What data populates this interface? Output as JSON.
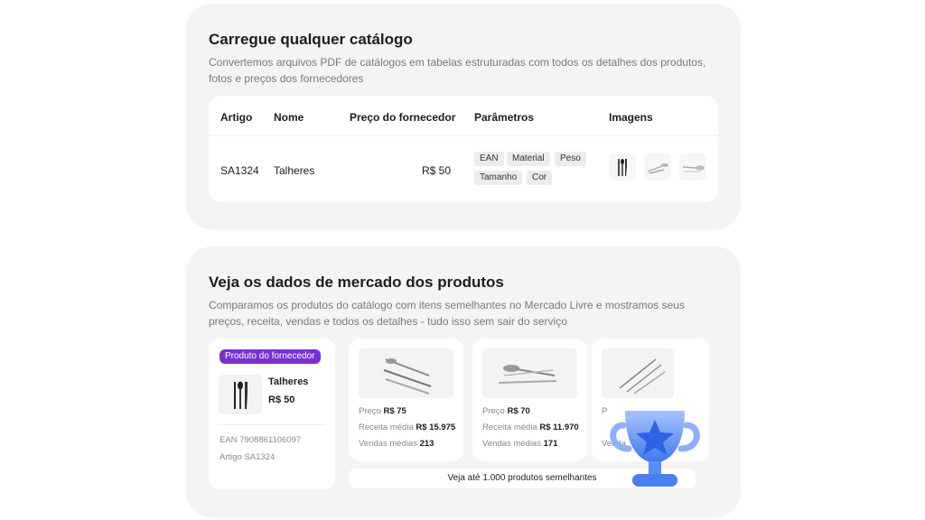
{
  "catalog": {
    "title": "Carregue qualquer catálogo",
    "description": "Convertemos arquivos PDF de catálogos em tabelas estruturadas com todos os detalhes dos produtos, fotos e preços dos fornecedores",
    "columns": [
      "Artigo",
      "Nome",
      "Preço do fornecedor",
      "Parâmetros",
      "Imagens"
    ],
    "row": {
      "article": "SA1324",
      "name": "Talheres",
      "price": "R$ 50",
      "params": [
        "EAN",
        "Material",
        "Peso",
        "Tamanho",
        "Cor"
      ],
      "images": [
        "cutlery-set-icon",
        "spoons-icon",
        "spoon-icon"
      ]
    }
  },
  "market": {
    "title": "Veja os dados de mercado dos produtos",
    "description": "Comparamos os produtos do catálogo com itens semelhantes no Mercado Livre e mostramos seus preços, receita, vendas e todos os detalhes - tudo isso sem sair do serviço",
    "supplier": {
      "badge": "Produto do fornecedor",
      "name": "Talheres",
      "price": "R$ 50",
      "ean_label": "EAN",
      "ean": "7908861106097",
      "article_label": "Artigo",
      "article": "SA1324"
    },
    "items": [
      {
        "price_label": "Preço",
        "price": "R$ 75",
        "revenue_label": "Receita média",
        "revenue": "R$ 15.975",
        "sales_label": "Vendas médias",
        "sales": "213"
      },
      {
        "price_label": "Preço",
        "price": "R$ 70",
        "revenue_label": "Receita média",
        "revenue": "R$ 11.970",
        "sales_label": "Vendas médias",
        "sales": "171"
      },
      {
        "price_label": "P",
        "price": "",
        "revenue_label": "",
        "revenue": "",
        "sales_label": "Venda",
        "sales": ""
      }
    ],
    "more_link": "Veja até 1.000 produtos semelhantes"
  },
  "colors": {
    "badge": "#7b2fd0",
    "trophy": "#5b8ef5",
    "card_bg": "#f4f4f4"
  }
}
